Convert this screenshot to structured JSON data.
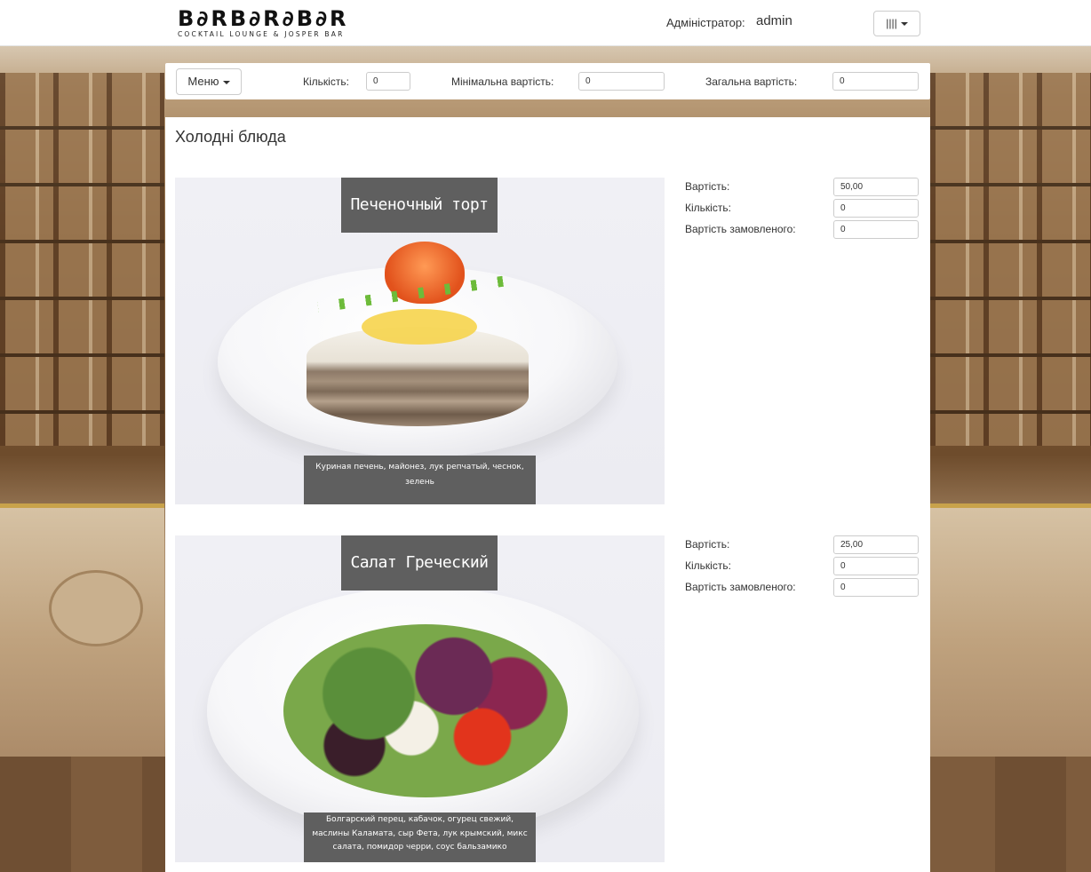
{
  "navbar": {
    "logo_main": "B∂RB∂R∂B∂R",
    "logo_sub": "COCKTAIL LOUNGE & JOSPER BAR",
    "admin_label": "Адміністратор:",
    "admin_name": "admin",
    "menu_button_label": "||||"
  },
  "filters": {
    "menu_label": "Меню",
    "quantity_label": "Кількість:",
    "quantity_value": "0",
    "min_cost_label": "Мінімальна вартість:",
    "min_cost_value": "0",
    "total_cost_label": "Загальна вартість:",
    "total_cost_value": "0"
  },
  "section": {
    "title": "Холодні блюда"
  },
  "dishes": [
    {
      "title": "Печеночный торт",
      "description": "Куриная печень, майонез, лук репчатый, чеснок, зелень",
      "cost_label": "Вартість:",
      "cost_value": "50,00",
      "qty_label": "Кількість:",
      "qty_value": "0",
      "ordered_label": "Вартість замовленого:",
      "ordered_value": "0"
    },
    {
      "title": "Салат Греческий",
      "description": "Болгарский перец, кабачок, огурец свежий, маслины Каламата, сыр Фета, лук крымский, микс салата, помидор черри, соус бальзамико",
      "cost_label": "Вартість:",
      "cost_value": "25,00",
      "qty_label": "Кількість:",
      "qty_value": "0",
      "ordered_label": "Вартість замовленого:",
      "ordered_value": "0"
    }
  ]
}
